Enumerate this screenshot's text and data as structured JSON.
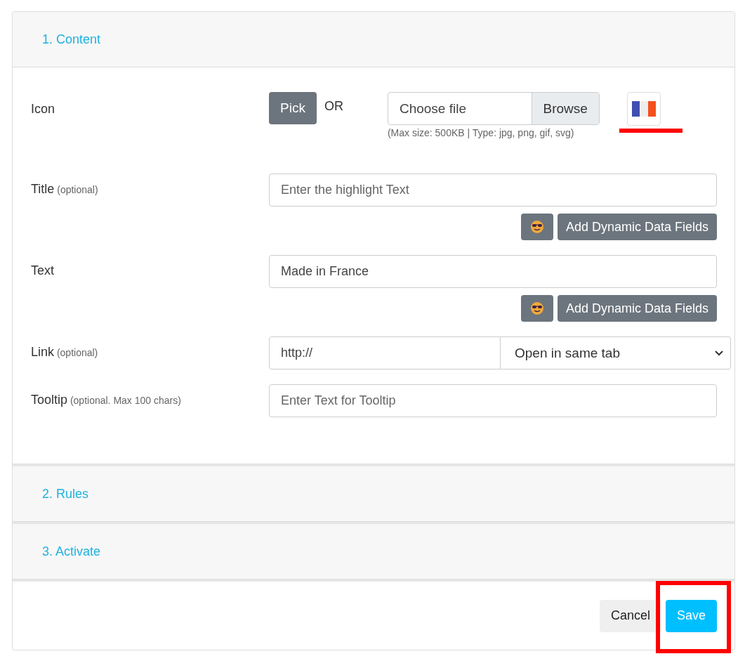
{
  "sections": [
    {
      "title": "1. Content",
      "expanded": true
    },
    {
      "title": "2. Rules",
      "expanded": false
    },
    {
      "title": "3. Activate",
      "expanded": false
    }
  ],
  "content": {
    "icon": {
      "label": "Icon",
      "pick_button": "Pick",
      "or_text": "OR",
      "file_placeholder": "Choose file",
      "browse_button": "Browse",
      "hint": "(Max size: 500KB | Type: jpg, png, gif, svg)"
    },
    "fields": [
      {
        "kind": "text",
        "label": "Title",
        "note": "(optional)",
        "placeholder": "Enter the highlight Text",
        "dynamic_button": "Add Dynamic Data Fields"
      },
      {
        "kind": "text",
        "label": "Text",
        "value": "Made in France",
        "dynamic_button": "Add Dynamic Data Fields"
      },
      {
        "kind": "link",
        "label": "Link",
        "note": "(optional)",
        "value": "http://",
        "select": "Open in same tab"
      },
      {
        "kind": "text",
        "label": "Tooltip",
        "note": "(optional. Max 100 chars)",
        "placeholder": "Enter Text for Tooltip"
      }
    ]
  },
  "footer": {
    "buttons": [
      {
        "kind": "secondary",
        "label": "Cancel"
      },
      {
        "kind": "primary",
        "label": "Save"
      }
    ]
  }
}
